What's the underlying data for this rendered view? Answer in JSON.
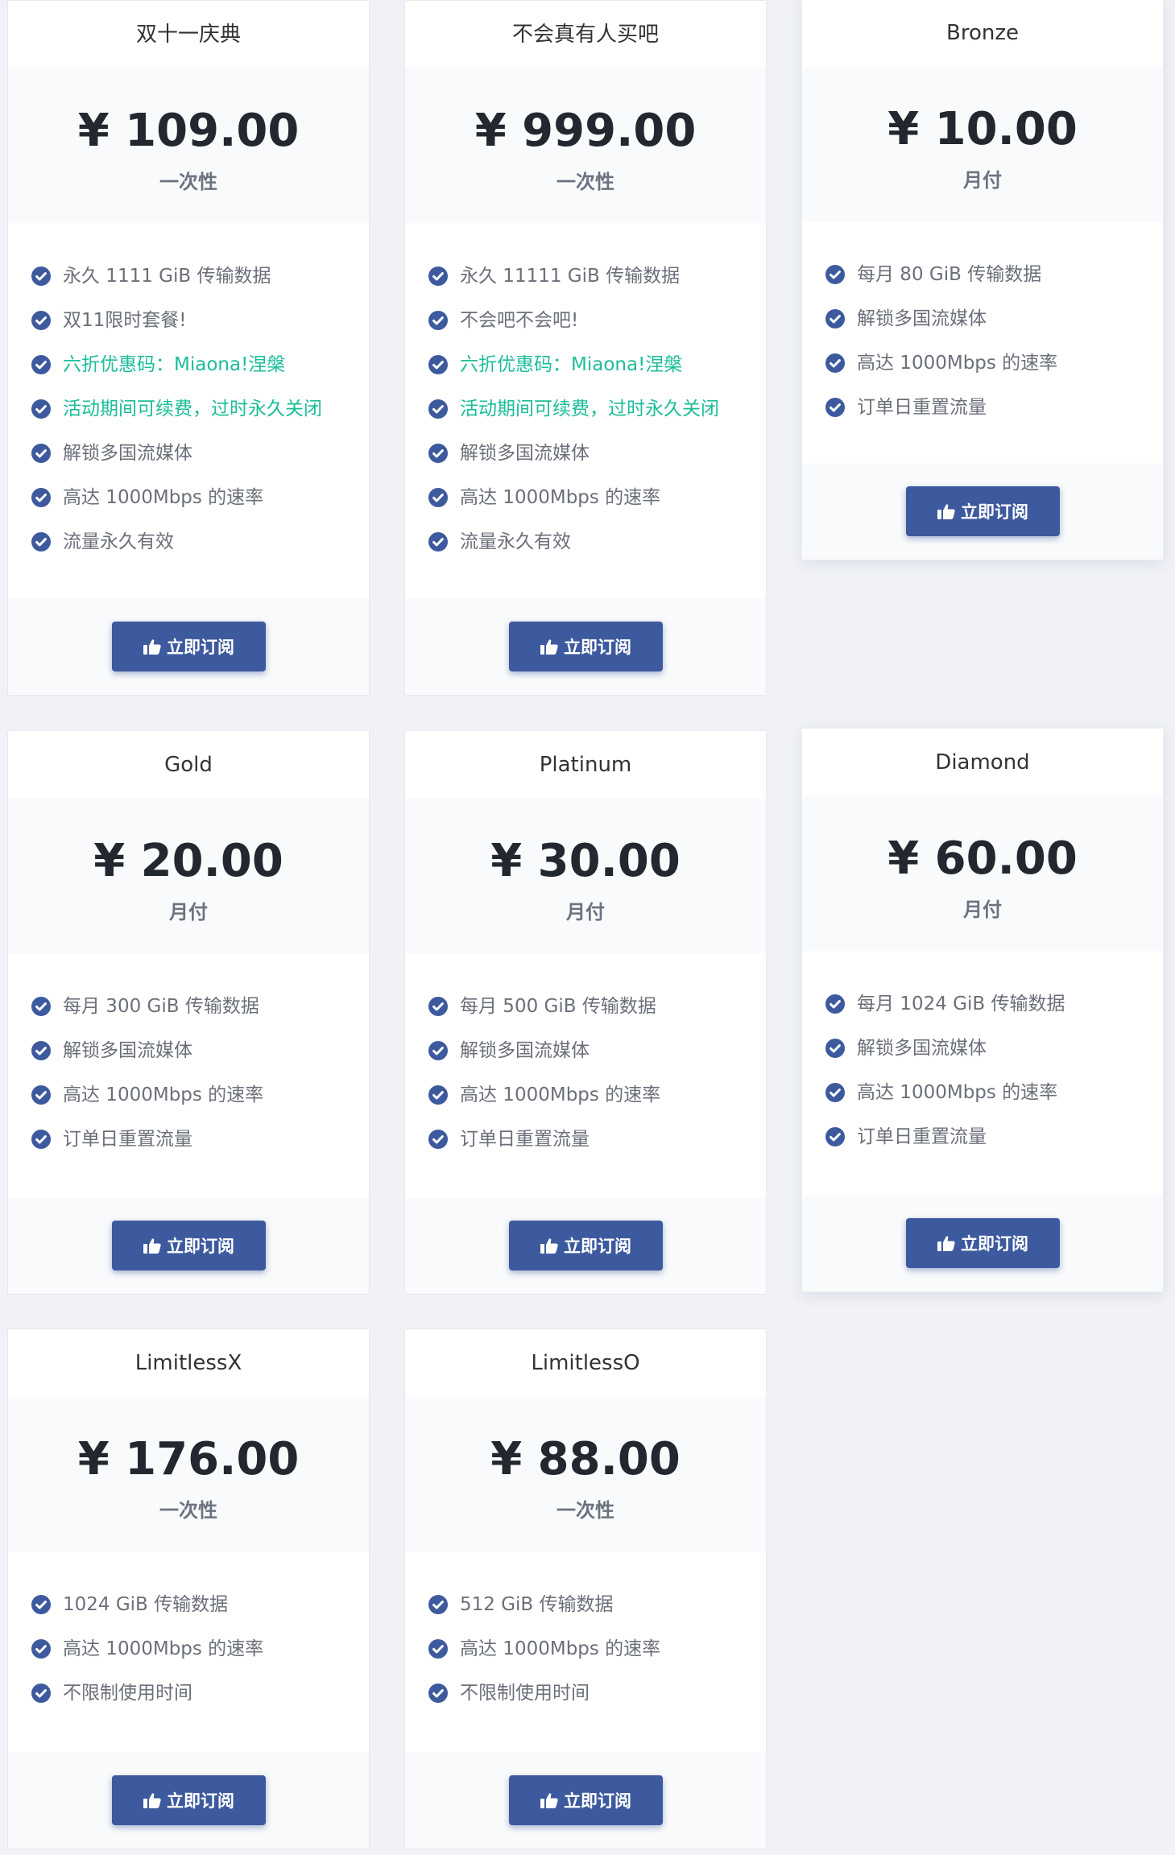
{
  "subscribe_label": "立即订阅",
  "icons": {
    "feature_check": "check-circle-icon",
    "subscribe": "thumbs-up-icon"
  },
  "colors": {
    "primary": "#3d5a9e",
    "highlight": "#1bbd9a",
    "text": "#6b6f7a",
    "price": "#23272f"
  },
  "plans": [
    {
      "name": "双十一庆典",
      "price": "¥ 109.00",
      "period": "一次性",
      "features": [
        {
          "text": "永久 1111 GiB 传输数据",
          "highlight": false
        },
        {
          "text": "双11限时套餐!",
          "highlight": false
        },
        {
          "text": "六折优惠码：Miaona!涅槃",
          "highlight": true
        },
        {
          "text": "活动期间可续费，过时永久关闭",
          "highlight": true
        },
        {
          "text": "解锁多国流媒体",
          "highlight": false
        },
        {
          "text": "高达 1000Mbps 的速率",
          "highlight": false
        },
        {
          "text": "流量永久有效",
          "highlight": false
        }
      ]
    },
    {
      "name": "不会真有人买吧",
      "price": "¥ 999.00",
      "period": "一次性",
      "features": [
        {
          "text": "永久 11111 GiB 传输数据",
          "highlight": false
        },
        {
          "text": "不会吧不会吧!",
          "highlight": false
        },
        {
          "text": "六折优惠码：Miaona!涅槃",
          "highlight": true
        },
        {
          "text": "活动期间可续费，过时永久关闭",
          "highlight": true
        },
        {
          "text": "解锁多国流媒体",
          "highlight": false
        },
        {
          "text": "高达 1000Mbps 的速率",
          "highlight": false
        },
        {
          "text": "流量永久有效",
          "highlight": false
        }
      ]
    },
    {
      "name": "Bronze",
      "price": "¥ 10.00",
      "period": "月付",
      "features": [
        {
          "text": "每月 80 GiB 传输数据",
          "highlight": false
        },
        {
          "text": "解锁多国流媒体",
          "highlight": false
        },
        {
          "text": "高达 1000Mbps 的速率",
          "highlight": false
        },
        {
          "text": "订单日重置流量",
          "highlight": false
        }
      ]
    },
    {
      "name": "Gold",
      "price": "¥ 20.00",
      "period": "月付",
      "features": [
        {
          "text": "每月 300 GiB 传输数据",
          "highlight": false
        },
        {
          "text": "解锁多国流媒体",
          "highlight": false
        },
        {
          "text": "高达 1000Mbps 的速率",
          "highlight": false
        },
        {
          "text": "订单日重置流量",
          "highlight": false
        }
      ]
    },
    {
      "name": "Platinum",
      "price": "¥ 30.00",
      "period": "月付",
      "features": [
        {
          "text": "每月 500 GiB 传输数据",
          "highlight": false
        },
        {
          "text": "解锁多国流媒体",
          "highlight": false
        },
        {
          "text": "高达 1000Mbps 的速率",
          "highlight": false
        },
        {
          "text": "订单日重置流量",
          "highlight": false
        }
      ]
    },
    {
      "name": "Diamond",
      "price": "¥ 60.00",
      "period": "月付",
      "features": [
        {
          "text": "每月 1024 GiB 传输数据",
          "highlight": false
        },
        {
          "text": "解锁多国流媒体",
          "highlight": false
        },
        {
          "text": "高达 1000Mbps 的速率",
          "highlight": false
        },
        {
          "text": "订单日重置流量",
          "highlight": false
        }
      ]
    },
    {
      "name": "LimitlessX",
      "price": "¥ 176.00",
      "period": "一次性",
      "features": [
        {
          "text": "1024 GiB 传输数据",
          "highlight": false
        },
        {
          "text": "高达 1000Mbps 的速率",
          "highlight": false
        },
        {
          "text": "不限制使用时间",
          "highlight": false
        }
      ]
    },
    {
      "name": "LimitlessO",
      "price": "¥ 88.00",
      "period": "一次性",
      "features": [
        {
          "text": "512 GiB 传输数据",
          "highlight": false
        },
        {
          "text": "高达 1000Mbps 的速率",
          "highlight": false
        },
        {
          "text": "不限制使用时间",
          "highlight": false
        }
      ]
    }
  ]
}
